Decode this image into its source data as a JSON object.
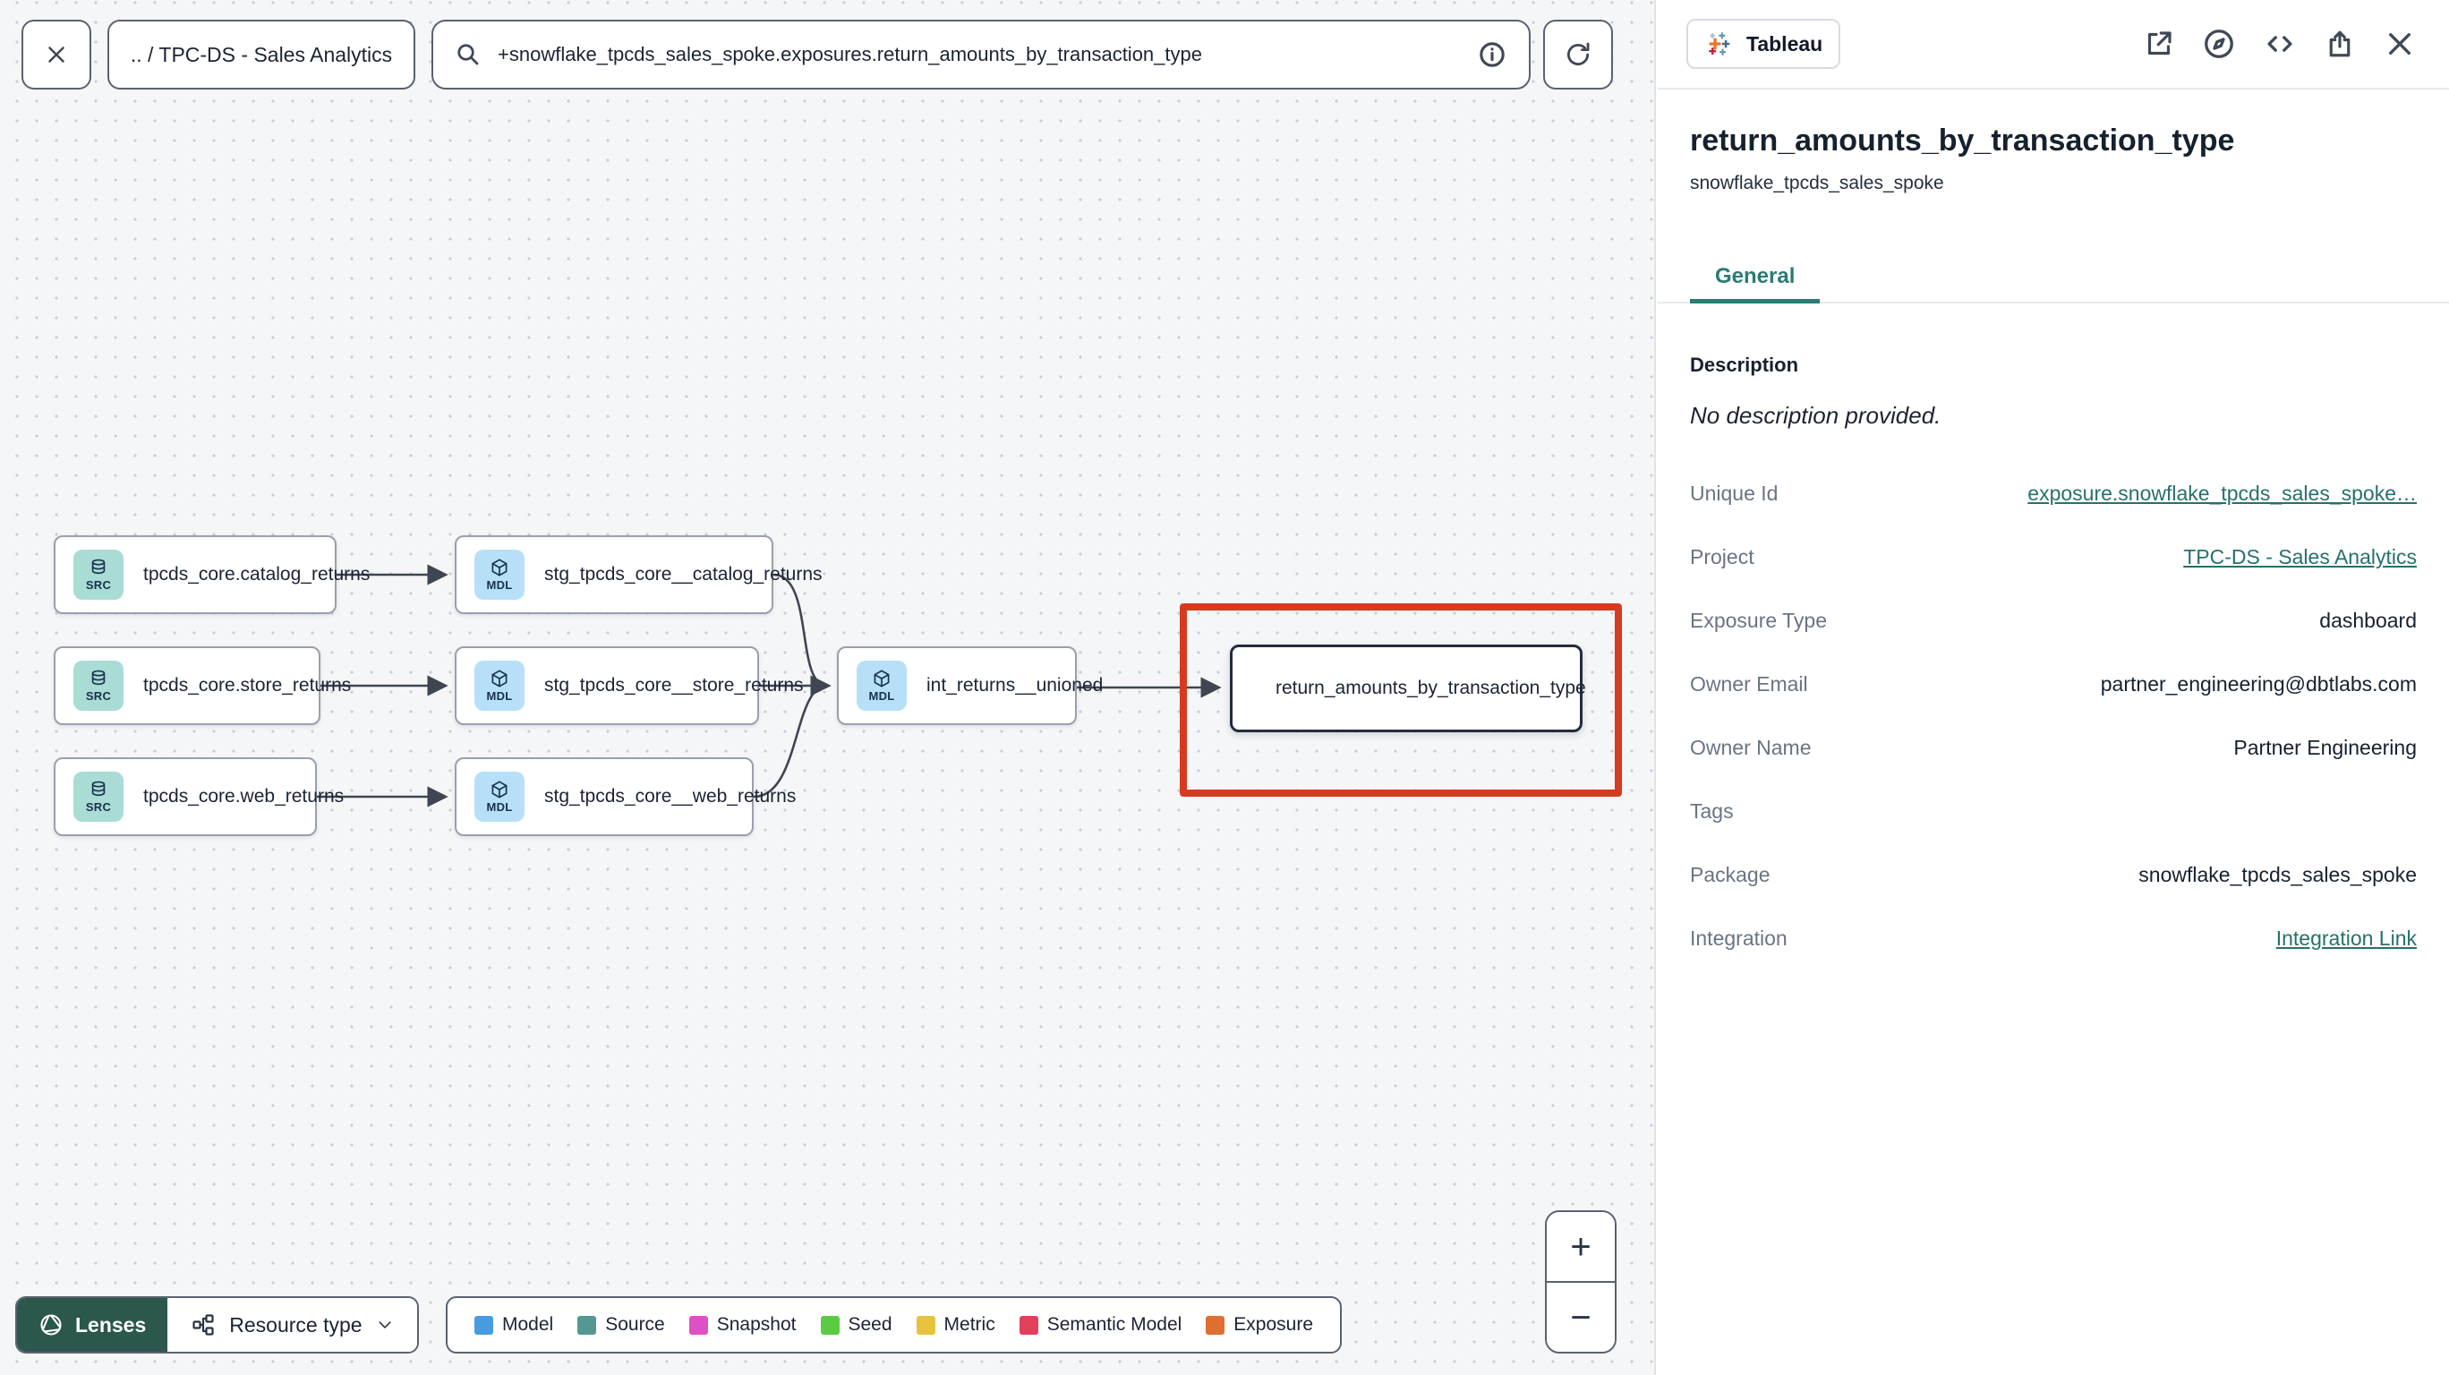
{
  "topbar": {
    "breadcrumb": ".. / TPC-DS - Sales Analytics",
    "search_value": "+snowflake_tpcds_sales_spoke.exposures.return_amounts_by_transaction_type"
  },
  "graph": {
    "nodes": [
      {
        "badge": "SRC",
        "label": "tpcds_core.catalog_returns"
      },
      {
        "badge": "SRC",
        "label": "tpcds_core.store_returns"
      },
      {
        "badge": "SRC",
        "label": "tpcds_core.web_returns"
      },
      {
        "badge": "MDL",
        "label": "stg_tpcds_core__catalog_returns"
      },
      {
        "badge": "MDL",
        "label": "stg_tpcds_core__store_returns"
      },
      {
        "badge": "MDL",
        "label": "stg_tpcds_core__web_returns"
      },
      {
        "badge": "MDL",
        "label": "int_returns__unioned"
      },
      {
        "label": "return_amounts_by_transaction_type"
      }
    ],
    "zoom_controls": {
      "zoom_in": "+",
      "zoom_out": "−"
    }
  },
  "footer": {
    "lenses_label": "Lenses",
    "resource_type_label": "Resource type",
    "legend": [
      {
        "label": "Model",
        "color": "#479ce1"
      },
      {
        "label": "Source",
        "color": "#549795"
      },
      {
        "label": "Snapshot",
        "color": "#de50c5"
      },
      {
        "label": "Seed",
        "color": "#5ccb44"
      },
      {
        "label": "Metric",
        "color": "#e7c33c"
      },
      {
        "label": "Semantic Model",
        "color": "#e23f5c"
      },
      {
        "label": "Exposure",
        "color": "#dd6f33"
      }
    ]
  },
  "panel": {
    "integration_badge": "Tableau",
    "title": "return_amounts_by_transaction_type",
    "subtitle": "snowflake_tpcds_sales_spoke",
    "active_tab": "General",
    "description_heading": "Description",
    "description_empty": "No description provided.",
    "rows": [
      {
        "label": "Unique Id",
        "value": "exposure.snowflake_tpcds_sales_spoke…"
      },
      {
        "label": "Project",
        "value": "TPC-DS - Sales Analytics"
      },
      {
        "label": "Exposure Type",
        "value": "dashboard"
      },
      {
        "label": "Owner Email",
        "value": "partner_engineering@dbtlabs.com"
      },
      {
        "label": "Owner Name",
        "value": "Partner Engineering"
      },
      {
        "label": "Tags",
        "value": ""
      },
      {
        "label": "Package",
        "value": "snowflake_tpcds_sales_spoke"
      },
      {
        "label": "Integration",
        "value": "Integration Link"
      }
    ]
  },
  "colors": {
    "accent": "#2b7a74",
    "link": "#26716b",
    "highlight": "#d63b20",
    "lenses_bg": "#2b574c",
    "source_badge": "#a9dcd4",
    "model_badge": "#b7e0f8",
    "edge": "#3f4652"
  }
}
